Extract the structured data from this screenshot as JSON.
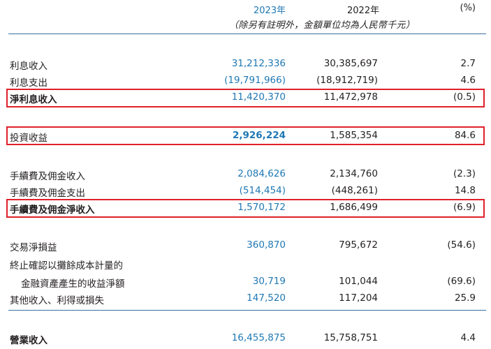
{
  "header": {
    "year_current": "2023年",
    "year_prior": "2022年",
    "pct": "(%)",
    "note": "（除另有註明外，金額單位均為人民幣千元）"
  },
  "rows": [
    {
      "label": "利息收入",
      "v2023": "31,212,336",
      "v2022": "30,385,697",
      "pct": "2.7"
    },
    {
      "label": "利息支出",
      "v2023": "(19,791,966)",
      "v2022": "(18,912,719)",
      "pct": "4.6"
    },
    {
      "label": "淨利息收入",
      "v2023": "11,420,370",
      "v2022": "11,472,978",
      "pct": "(0.5)"
    },
    {
      "label": "投資收益",
      "v2023": "2,926,224",
      "v2022": "1,585,354",
      "pct": "84.6"
    },
    {
      "label": "手續費及佣金收入",
      "v2023": "2,084,626",
      "v2022": "2,134,760",
      "pct": "(2.3)"
    },
    {
      "label": "手續費及佣金支出",
      "v2023": "(514,454)",
      "v2022": "(448,261)",
      "pct": "14.8"
    },
    {
      "label": "手續費及佣金淨收入",
      "v2023": "1,570,172",
      "v2022": "1,686,499",
      "pct": "(6.9)"
    },
    {
      "label": "交易淨損益",
      "v2023": "360,870",
      "v2022": "795,672",
      "pct": "(54.6)"
    },
    {
      "label": "終止確認以攤餘成本計量的",
      "v2023": "",
      "v2022": "",
      "pct": ""
    },
    {
      "label": "金融資產產生的收益淨額",
      "v2023": "30,719",
      "v2022": "101,044",
      "pct": "(69.6)"
    },
    {
      "label": "其他收入、利得或損失",
      "v2023": "147,520",
      "v2022": "117,204",
      "pct": "25.9"
    },
    {
      "label": "營業收入",
      "v2023": "16,455,875",
      "v2022": "15,758,751",
      "pct": "4.4"
    }
  ],
  "colors": {
    "accent": "#1f78b4",
    "highlight_border": "#e0202a",
    "rule": "#3c6e9e"
  }
}
